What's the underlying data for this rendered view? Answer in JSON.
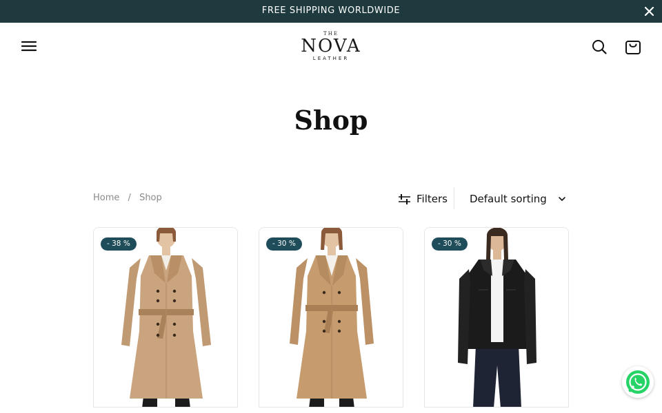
{
  "announcement": {
    "text": "FREE SHIPPING WORLDWIDE"
  },
  "header": {
    "logo": {
      "the": "THE",
      "name": "NOVA",
      "sub": "LEATHER"
    }
  },
  "page": {
    "title": "Shop"
  },
  "breadcrumb": {
    "home": "Home",
    "separator": "/",
    "current": "Shop"
  },
  "toolbar": {
    "filters_label": "Filters",
    "sort_label": "Default sorting"
  },
  "products": [
    {
      "badge": "- 38 %",
      "coat_color": "#c9a47e",
      "item": "trench-coat"
    },
    {
      "badge": "- 30 %",
      "coat_color": "#c69c6f",
      "item": "trench-coat"
    },
    {
      "badge": "- 30 %",
      "coat_color": "#1b1b1b",
      "item": "leather-jacket"
    }
  ],
  "colors": {
    "announcement_bg": "#1f3a3f",
    "badge_bg": "#1f4e5a",
    "whatsapp": "#25d366"
  }
}
